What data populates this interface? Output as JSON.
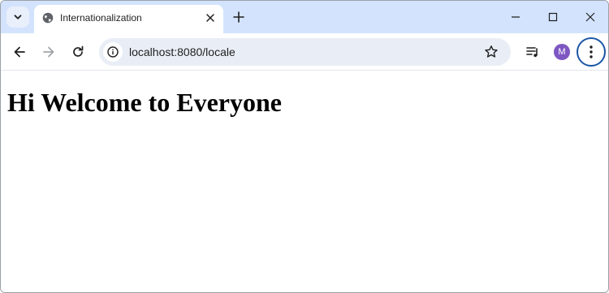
{
  "tab": {
    "title": "Internationalization",
    "favicon": "globe-icon"
  },
  "toolbar": {
    "url": "localhost:8080/locale"
  },
  "profile": {
    "initial": "M",
    "color": "#7e57c2"
  },
  "page": {
    "heading": "Hi Welcome to Everyone"
  },
  "colors": {
    "tabstrip": "#d3e3fd",
    "omnibox": "#e9eef6",
    "focus_ring": "#1a56a6"
  }
}
